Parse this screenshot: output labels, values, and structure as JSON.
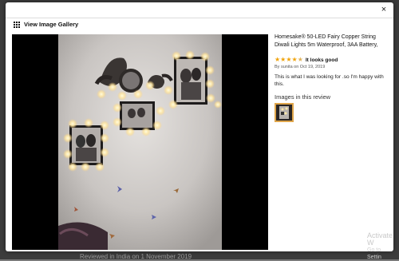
{
  "background": {
    "fragment": "Reviewed in India on 1 November 2019"
  },
  "modal": {
    "close_label": "×",
    "gallery_label": "View Image Gallery"
  },
  "review": {
    "product_title": "Homesake® 50-LED Fairy Copper String Diwali Lights 5m Waterproof, 3AA Battery,",
    "rating": 4.5,
    "review_title": "It looks good",
    "byline": "By sunita on Oct 19, 2019",
    "body": "This is what I was looking for .so I'm happy with this.",
    "images_heading": "Images in this review"
  },
  "watermark": {
    "line1": "Activate W",
    "line2": "Go to Settin"
  },
  "colors": {
    "star": "#f0a30a",
    "thumb_border": "#e0a64b"
  }
}
